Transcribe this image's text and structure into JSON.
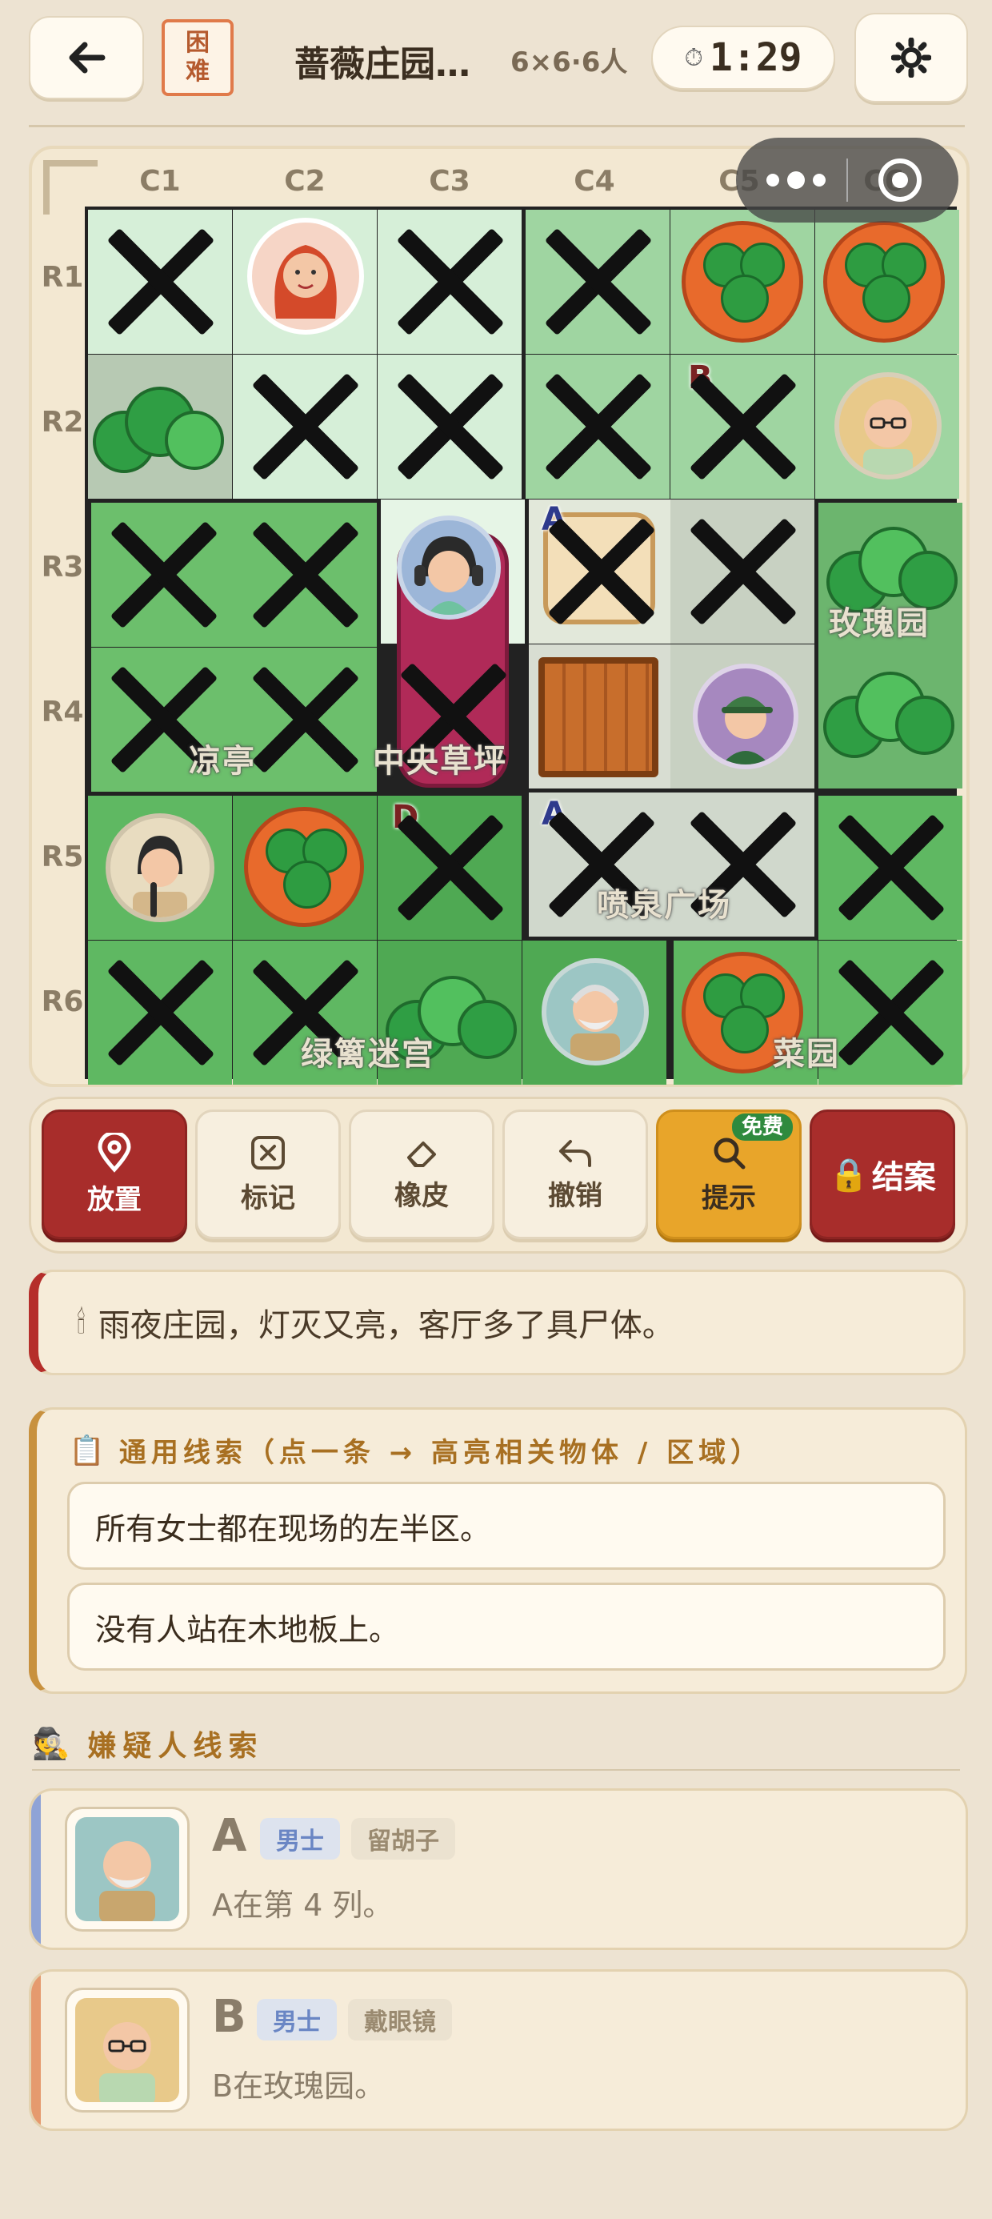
{
  "header": {
    "back_icon": "arrow-left-icon",
    "difficulty": "困难",
    "title": "蔷薇庄园…",
    "meta": "6×6·6人",
    "timer_icon": "stopwatch-icon",
    "timer": "1:29",
    "settings_icon": "gear-icon"
  },
  "mini_program": {
    "more_icon": "more-dots-icon",
    "close_icon": "target-close-icon"
  },
  "board": {
    "columns": [
      "C1",
      "C2",
      "C3",
      "C4",
      "C5",
      "C6"
    ],
    "rows": [
      "R1",
      "R2",
      "R3",
      "R4",
      "R5",
      "R6"
    ],
    "zones": [
      {
        "name": "凉亭"
      },
      {
        "name": "中央草坪"
      },
      {
        "name": "玫瑰园"
      },
      {
        "name": "喷泉广场"
      },
      {
        "name": "绿篱迷宫"
      },
      {
        "name": "菜园"
      }
    ],
    "cell_labels": {
      "r2c5": "B",
      "r3c4": "A",
      "r5c3": "D",
      "r5c4": "A"
    }
  },
  "toolbar": {
    "place": {
      "label": "放置",
      "icon": "map-pin-icon"
    },
    "mark": {
      "label": "标记",
      "icon": "x-box-icon"
    },
    "eraser": {
      "label": "橡皮",
      "icon": "eraser-icon"
    },
    "undo": {
      "label": "撤销",
      "icon": "undo-icon"
    },
    "hint": {
      "label": "提示",
      "badge": "免费",
      "icon": "search-icon"
    },
    "solve": {
      "label": "结案",
      "icon": "lock-icon"
    }
  },
  "story": {
    "icon": "candle-icon",
    "text": "雨夜庄园，灯灭又亮，客厅多了具尸体。"
  },
  "general_clues": {
    "icon": "clipboard-icon",
    "title": "通用线索（点一条 → 高亮相关物体 / 区域）",
    "items": [
      "所有女士都在现场的左半区。",
      "没有人站在木地板上。"
    ]
  },
  "suspect_clues": {
    "icon": "detective-icon",
    "title": "嫌疑人线索",
    "items": [
      {
        "letter": "A",
        "tags": [
          "男士",
          "留胡子"
        ],
        "text": "A在第 4 列。",
        "accent": "#8fa3d6"
      },
      {
        "letter": "B",
        "tags": [
          "男士",
          "戴眼镜"
        ],
        "text": "B在玫瑰园。",
        "accent": "#e59a6e"
      }
    ]
  },
  "colors": {
    "accent_red": "#a82d2b",
    "hint_yellow": "#e8a52a",
    "difficulty_orange": "#e07a4a"
  }
}
